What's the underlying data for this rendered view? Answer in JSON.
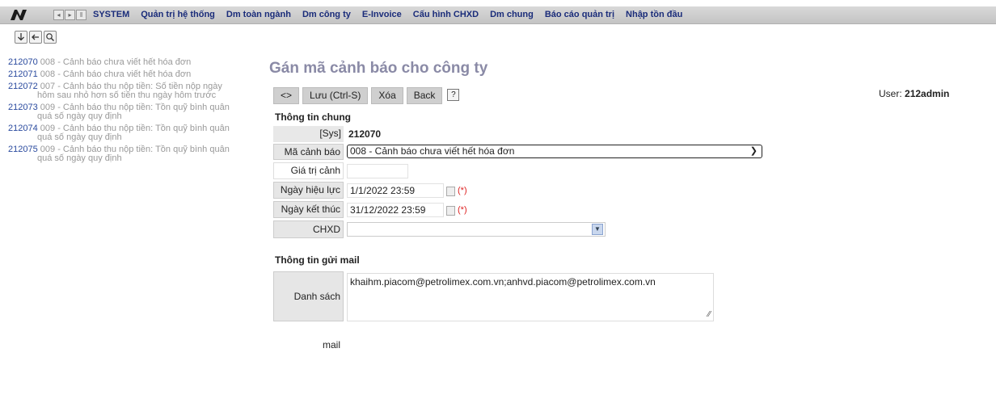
{
  "menu": {
    "items": [
      "SYSTEM",
      "Quản trị hệ thống",
      "Dm toàn ngành",
      "Dm công ty",
      "E-Invoice",
      "Cấu hình CHXD",
      "Dm chung",
      "Báo cáo quản trị",
      "Nhập tồn đầu"
    ]
  },
  "left_list": [
    {
      "code": "212070",
      "text": "008 - Cảnh báo chưa viết hết hóa đơn",
      "cont": ""
    },
    {
      "code": "212071",
      "text": "008 - Cảnh báo chưa viết hết hóa đơn",
      "cont": ""
    },
    {
      "code": "212072",
      "text": "007 - Cảnh báo thu nộp tiền: Số tiền nộp ngày",
      "cont": "hôm sau nhỏ hơn số tiền thu ngày hôm trước"
    },
    {
      "code": "212073",
      "text": "009 - Cảnh báo thu nộp tiền: Tồn quỹ bình quân",
      "cont": "quá số ngày quy định"
    },
    {
      "code": "212074",
      "text": "009 - Cảnh báo thu nộp tiền: Tồn quỹ bình quân",
      "cont": "quá số ngày quy định"
    },
    {
      "code": "212075",
      "text": "009 - Cảnh báo thu nộp tiền: Tồn quỹ bình quân",
      "cont": "quá số ngày quy định"
    }
  ],
  "page_title": "Gán mã cảnh báo cho công ty",
  "buttons": {
    "toggle": "<>",
    "save": "Lưu (Ctrl-S)",
    "delete": "Xóa",
    "back": "Back",
    "help": "?"
  },
  "user": {
    "label": "User:",
    "name": "212admin"
  },
  "general": {
    "title": "Thông tin chung",
    "sys_label": "[Sys]",
    "sys_value": "212070",
    "ma_canh_bao_label": "Mã cảnh báo",
    "ma_canh_bao_value": "008 - Cảnh báo chưa viết hết hóa đơn",
    "gia_tri_label": "Giá trị cảnh báo",
    "gia_tri_value": "",
    "ngay_hieu_luc_label": "Ngày hiệu lực",
    "ngay_hieu_luc_value": "1/1/2022 23:59",
    "ngay_ket_thuc_label": "Ngày kết thúc",
    "ngay_ket_thuc_value": "31/12/2022 23:59",
    "required_mark": "(*)",
    "chxd_label": "CHXD",
    "chxd_value": ""
  },
  "mail": {
    "title": "Thông tin gửi mail",
    "list_label": "Danh sách mail",
    "list_value": "khaihm.piacom@petrolimex.com.vn;anhvd.piacom@petrolimex.com.vn"
  }
}
